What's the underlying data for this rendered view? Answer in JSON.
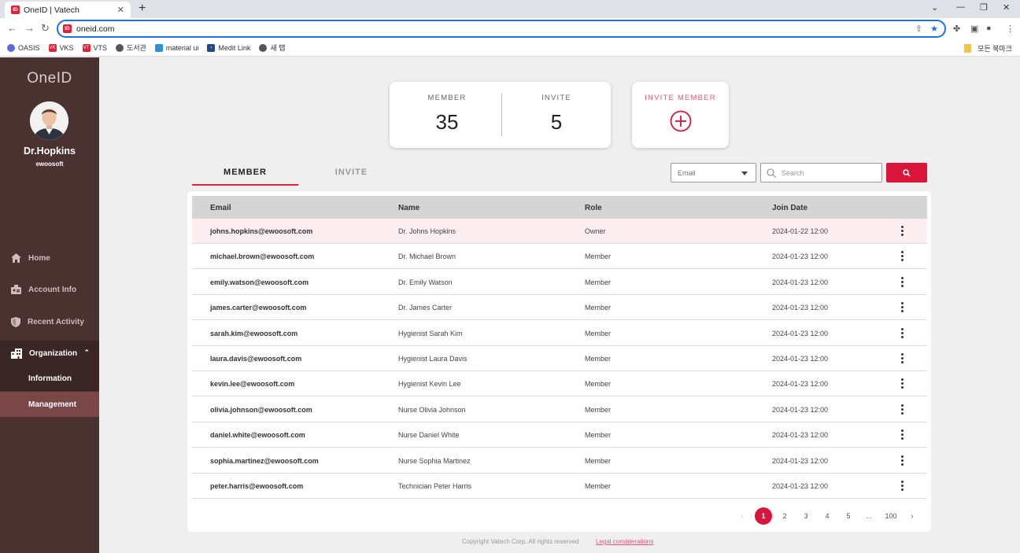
{
  "browser": {
    "tab_title": "OneID | Vatech",
    "favicon_text": "ID",
    "url": "oneid.com",
    "bookmarks": [
      "OASIS",
      "VKS",
      "VTS",
      "도서관",
      "material ui",
      "Medit Link",
      "새 탭"
    ],
    "all_bookmarks_label": "모든 북마크"
  },
  "sidebar": {
    "logo": "OneID",
    "user_name": "Dr.Hopkins",
    "user_org": "ewoosoft",
    "nav": {
      "home": "Home",
      "account_info": "Account Info",
      "recent_activity": "Recent Activity",
      "organization": "Organization",
      "information": "Information",
      "management": "Management"
    }
  },
  "stats": {
    "member_label": "MEMBER",
    "member_count": "35",
    "invite_label": "INVITE",
    "invite_count": "5",
    "invite_member_label": "INVITE MEMBER"
  },
  "tabs": {
    "member": "MEMBER",
    "invite": "INVITE"
  },
  "search": {
    "filter_value": "Email",
    "placeholder": "Search"
  },
  "table": {
    "headers": {
      "email": "Email",
      "name": "Name",
      "role": "Role",
      "join_date": "Join Date"
    },
    "rows": [
      {
        "email": "johns.hopkins@ewoosoft.com",
        "name": "Dr. Johns Hopkins",
        "role": "Owner",
        "join_date": "2024-01-22 12:00"
      },
      {
        "email": "michael.brown@ewoosoft.com",
        "name": "Dr. Michael Brown",
        "role": "Member",
        "join_date": "2024-01-23 12:00"
      },
      {
        "email": "emily.watson@ewoosoft.com",
        "name": "Dr. Emily Watson",
        "role": "Member",
        "join_date": "2024-01-23 12:00"
      },
      {
        "email": "james.carter@ewoosoft.com",
        "name": "Dr. James Carter",
        "role": "Member",
        "join_date": "2024-01-23 12:00"
      },
      {
        "email": "sarah.kim@ewoosoft.com",
        "name": "Hygienist Sarah Kim",
        "role": "Member",
        "join_date": "2024-01-23 12:00"
      },
      {
        "email": "laura.davis@ewoosoft.com",
        "name": "Hygienist Laura Davis",
        "role": "Member",
        "join_date": "2024-01-23 12:00"
      },
      {
        "email": "kevin.lee@ewoosoft.com",
        "name": "Hygienist Kevin Lee",
        "role": "Member",
        "join_date": "2024-01-23 12:00"
      },
      {
        "email": "olivia.johnson@ewoosoft.com",
        "name": "Nurse Olivia Johnson",
        "role": "Member",
        "join_date": "2024-01-23 12:00"
      },
      {
        "email": "daniel.white@ewoosoft.com",
        "name": "Nurse Daniel White",
        "role": "Member",
        "join_date": "2024-01-23 12:00"
      },
      {
        "email": "sophia.martinez@ewoosoft.com",
        "name": "Nurse Sophia Martinez",
        "role": "Member",
        "join_date": "2024-01-23 12:00"
      },
      {
        "email": "peter.harris@ewoosoft.com",
        "name": "Technician Peter Harris",
        "role": "Member",
        "join_date": "2024-01-23 12:00"
      }
    ]
  },
  "pagination": {
    "prev": "‹",
    "pages": [
      "1",
      "2",
      "3",
      "4",
      "5"
    ],
    "ellipsis": "...",
    "last": "100",
    "next": "›",
    "current": "1"
  },
  "footer": {
    "copyright": "Copyright Vatech Corp. All rights reserved",
    "legal": "Legal considerations"
  },
  "colors": {
    "accent": "#d9153a",
    "sidebar_bg": "#4a3230",
    "sidebar_selected": "#7a4748",
    "highlight_row": "#fdeff1"
  }
}
